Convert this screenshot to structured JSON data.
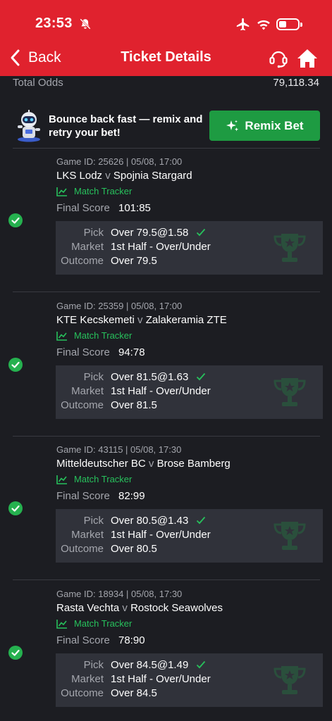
{
  "status_bar": {
    "time": "23:53"
  },
  "nav": {
    "back_label": "Back",
    "title": "Ticket Details"
  },
  "summary": {
    "total_odds_label": "Total Odds",
    "total_odds_value": "79,118.34"
  },
  "remix": {
    "message": "Bounce back fast — remix and retry your bet!",
    "button_label": "Remix Bet"
  },
  "colors": {
    "brand_red": "#e0222e",
    "success_green": "#1e9b42",
    "tracker_green": "#27c15c",
    "background": "#1c1d22"
  },
  "labels": {
    "match_tracker": "Match Tracker",
    "final_score": "Final Score",
    "pick": "Pick",
    "market": "Market",
    "outcome": "Outcome",
    "versus": "v"
  },
  "bets": [
    {
      "game_info": "Game ID: 25626 | 05/08, 17:00",
      "home": "LKS Lodz",
      "away": "Spojnia Stargard",
      "final_score": "101:85",
      "pick": "Over 79.5@1.58",
      "market": "1st Half - Over/Under",
      "outcome": "Over 79.5",
      "status": "won"
    },
    {
      "game_info": "Game ID: 25359 | 05/08, 17:00",
      "home": "KTE Kecskemeti",
      "away": "Zalakeramia ZTE",
      "final_score": "94:78",
      "pick": "Over 81.5@1.63",
      "market": "1st Half - Over/Under",
      "outcome": "Over 81.5",
      "status": "won"
    },
    {
      "game_info": "Game ID: 43115 | 05/08, 17:30",
      "home": "Mitteldeutscher BC",
      "away": "Brose Bamberg",
      "final_score": "82:99",
      "pick": "Over 80.5@1.43",
      "market": "1st Half - Over/Under",
      "outcome": "Over 80.5",
      "status": "won"
    },
    {
      "game_info": "Game ID: 18934 | 05/08, 17:30",
      "home": "Rasta Vechta",
      "away": "Rostock Seawolves",
      "final_score": "78:90",
      "pick": "Over 84.5@1.49",
      "market": "1st Half - Over/Under",
      "outcome": "Over 84.5",
      "status": "won"
    }
  ]
}
